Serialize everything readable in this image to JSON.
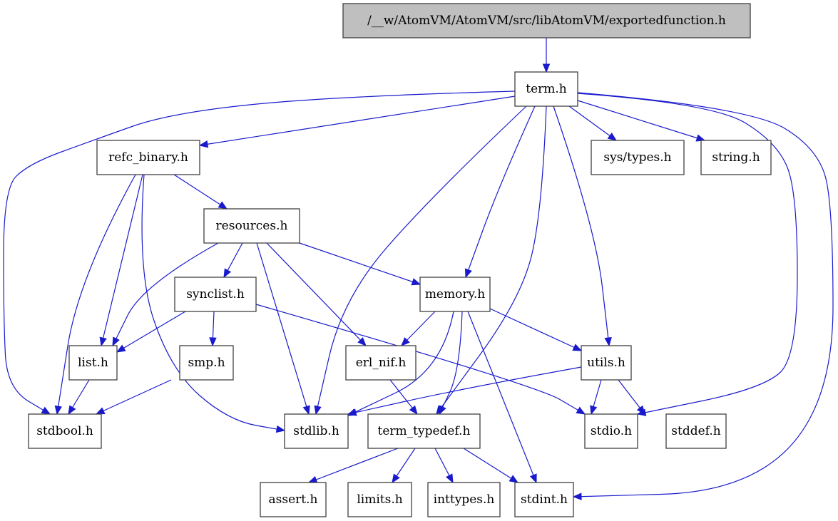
{
  "title": "/__w/AtomVM/AtomVM/src/libAtomVM/exportedfunction.h",
  "colors": {
    "edge": "#1a1acc",
    "root_fill": "#bfbfbf",
    "node_fill": "#ffffff",
    "node_border": "#404040"
  },
  "nodes": [
    {
      "id": "root",
      "label": "/__w/AtomVM/AtomVM/src/libAtomVM/exportedfunction.h",
      "root": true
    },
    {
      "id": "term",
      "label": "term.h"
    },
    {
      "id": "refc_binary",
      "label": "refc_binary.h"
    },
    {
      "id": "sys_types",
      "label": "sys/types.h"
    },
    {
      "id": "string",
      "label": "string.h"
    },
    {
      "id": "resources",
      "label": "resources.h"
    },
    {
      "id": "synclist",
      "label": "synclist.h"
    },
    {
      "id": "memory",
      "label": "memory.h"
    },
    {
      "id": "list",
      "label": "list.h"
    },
    {
      "id": "smp",
      "label": "smp.h"
    },
    {
      "id": "erl_nif",
      "label": "erl_nif.h"
    },
    {
      "id": "utils",
      "label": "utils.h"
    },
    {
      "id": "stdbool",
      "label": "stdbool.h"
    },
    {
      "id": "stdlib",
      "label": "stdlib.h"
    },
    {
      "id": "term_typedef",
      "label": "term_typedef.h"
    },
    {
      "id": "stdio",
      "label": "stdio.h"
    },
    {
      "id": "stddef",
      "label": "stddef.h"
    },
    {
      "id": "assert",
      "label": "assert.h"
    },
    {
      "id": "limits",
      "label": "limits.h"
    },
    {
      "id": "inttypes",
      "label": "inttypes.h"
    },
    {
      "id": "stdint",
      "label": "stdint.h"
    }
  ],
  "edges": [
    {
      "from": "root",
      "to": "term"
    },
    {
      "from": "term",
      "to": "refc_binary"
    },
    {
      "from": "term",
      "to": "sys_types"
    },
    {
      "from": "term",
      "to": "string"
    },
    {
      "from": "term",
      "to": "stdbool"
    },
    {
      "from": "term",
      "to": "stdlib"
    },
    {
      "from": "term",
      "to": "memory"
    },
    {
      "from": "term",
      "to": "term_typedef"
    },
    {
      "from": "term",
      "to": "utils"
    },
    {
      "from": "term",
      "to": "stdio"
    },
    {
      "from": "term",
      "to": "stdint"
    },
    {
      "from": "refc_binary",
      "to": "resources"
    },
    {
      "from": "refc_binary",
      "to": "list"
    },
    {
      "from": "refc_binary",
      "to": "stdbool"
    },
    {
      "from": "refc_binary",
      "to": "stdlib"
    },
    {
      "from": "resources",
      "to": "synclist"
    },
    {
      "from": "resources",
      "to": "memory"
    },
    {
      "from": "resources",
      "to": "list"
    },
    {
      "from": "resources",
      "to": "stdlib"
    },
    {
      "from": "resources",
      "to": "erl_nif"
    },
    {
      "from": "synclist",
      "to": "list"
    },
    {
      "from": "synclist",
      "to": "smp"
    },
    {
      "from": "synclist",
      "to": "stdio"
    },
    {
      "from": "memory",
      "to": "erl_nif"
    },
    {
      "from": "memory",
      "to": "utils"
    },
    {
      "from": "memory",
      "to": "stdlib"
    },
    {
      "from": "memory",
      "to": "term_typedef"
    },
    {
      "from": "memory",
      "to": "stdint"
    },
    {
      "from": "list",
      "to": "stdbool"
    },
    {
      "from": "smp",
      "to": "stdbool"
    },
    {
      "from": "erl_nif",
      "to": "term_typedef"
    },
    {
      "from": "utils",
      "to": "stdlib"
    },
    {
      "from": "utils",
      "to": "stdio"
    },
    {
      "from": "utils",
      "to": "stddef"
    },
    {
      "from": "term_typedef",
      "to": "assert"
    },
    {
      "from": "term_typedef",
      "to": "limits"
    },
    {
      "from": "term_typedef",
      "to": "inttypes"
    },
    {
      "from": "term_typedef",
      "to": "stdint"
    }
  ]
}
